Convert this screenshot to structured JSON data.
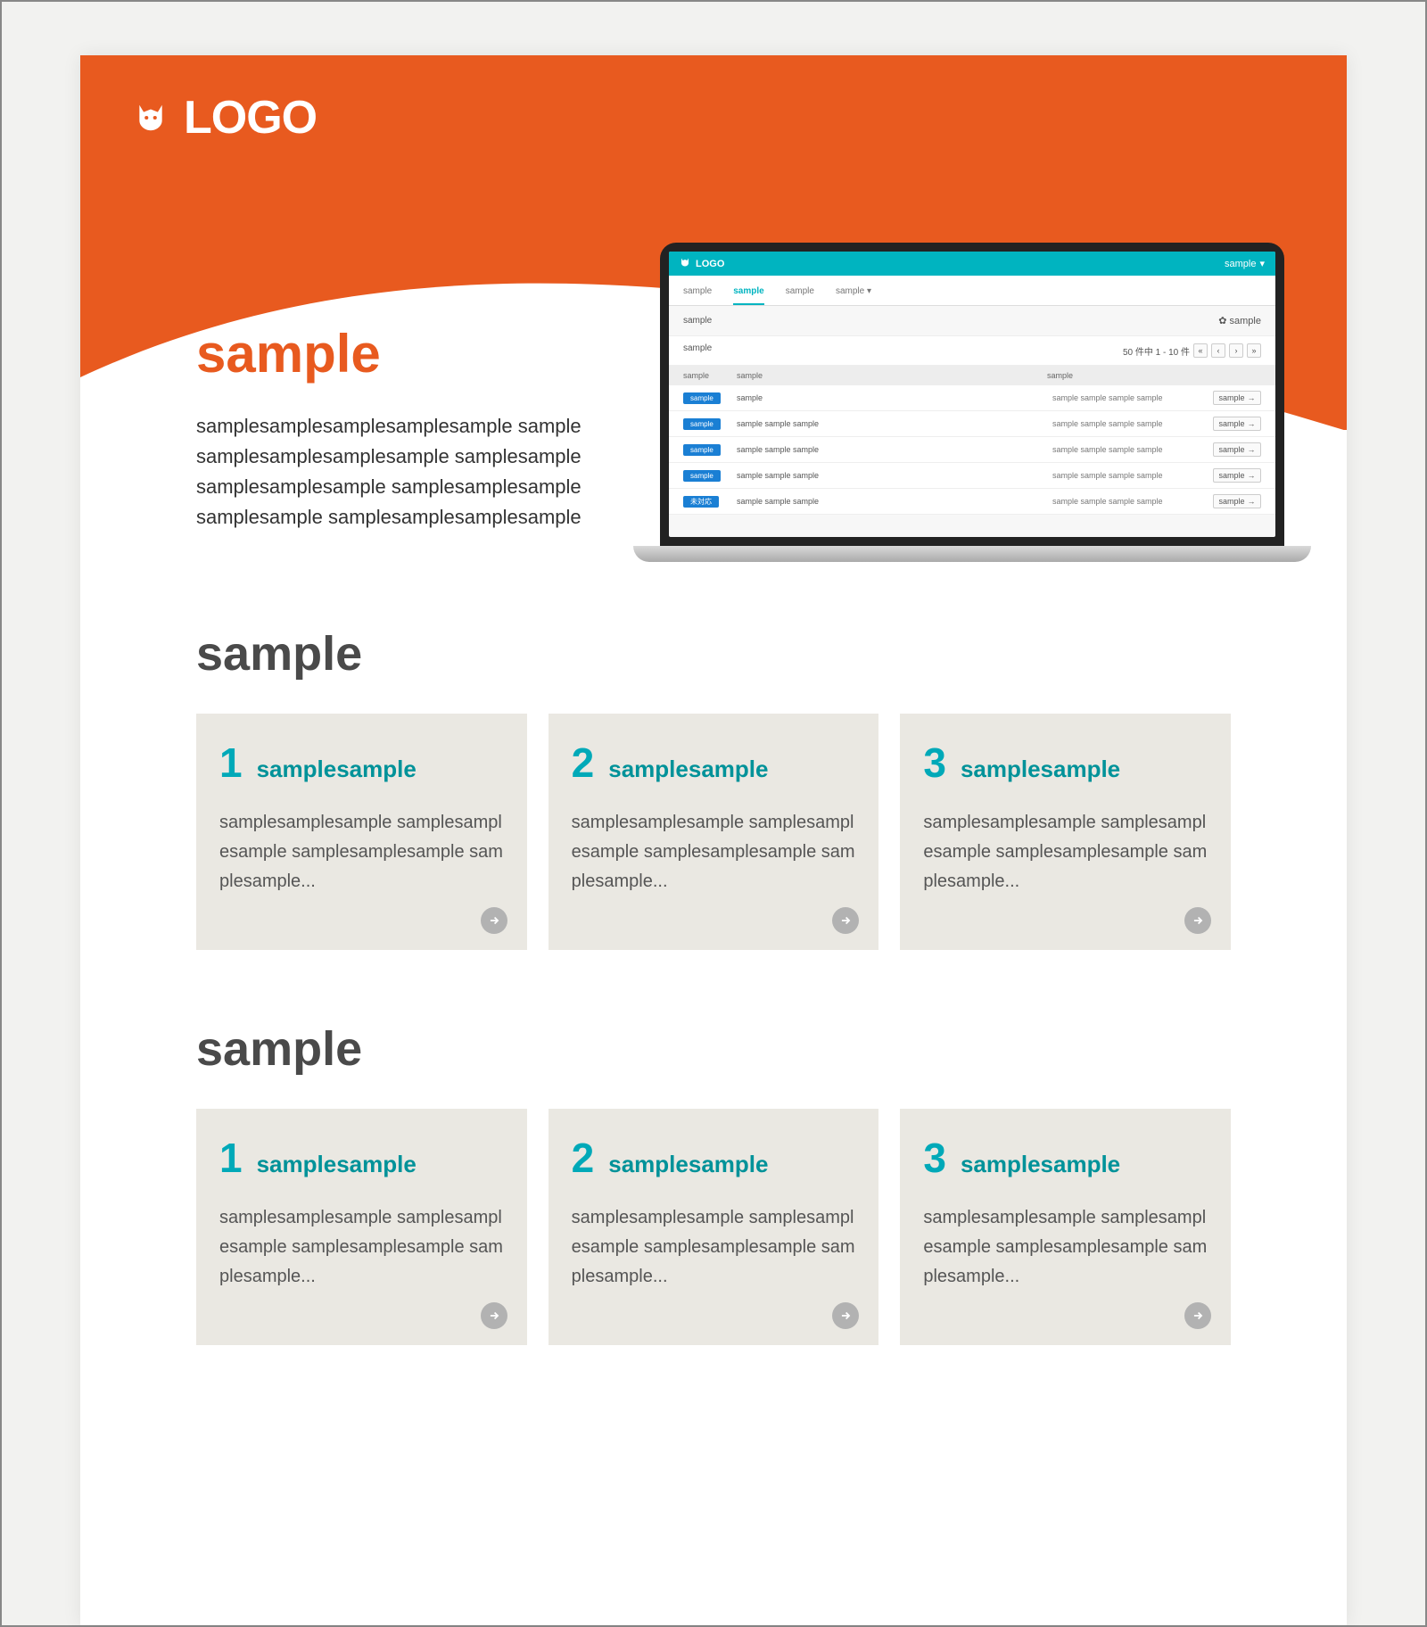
{
  "brand": {
    "logo_text": "LOGO"
  },
  "hero": {
    "title": "sample",
    "body": "samplesamplesamplesamplesample samplesamplesamplesamplesample samplesamplesamplesamplesample samplesamplesamplesamplesample samplesamplesamplesample"
  },
  "laptop": {
    "app_logo": "LOGO",
    "top_right": "sample",
    "tabs": [
      "sample",
      "sample",
      "sample",
      "sample"
    ],
    "page_title": "sample",
    "gear_label": "sample",
    "toolbar_left": "sample",
    "pager_text": "50 件中  1 - 10 件",
    "columns": {
      "c1": "sample",
      "c2": "sample",
      "c3": "sample"
    },
    "rows": [
      {
        "badge": "sample",
        "c2": "sample",
        "c3": "sample sample sample sample",
        "action": "sample"
      },
      {
        "badge": "sample",
        "c2": "sample sample sample",
        "c3": "sample sample sample sample",
        "action": "sample"
      },
      {
        "badge": "sample",
        "c2": "sample sample sample",
        "c3": "sample sample sample sample",
        "action": "sample"
      },
      {
        "badge": "sample",
        "c2": "sample sample sample",
        "c3": "sample sample sample sample",
        "action": "sample"
      },
      {
        "badge": "未対応",
        "c2": "sample sample sample",
        "c3": "sample sample sample sample",
        "action": "sample"
      }
    ]
  },
  "section1": {
    "heading": "sample",
    "cards": [
      {
        "num": "1",
        "title": "samplesample",
        "body": "samplesamplesample samplesamplesample samplesamplesample samplesample..."
      },
      {
        "num": "2",
        "title": "samplesample",
        "body": "samplesamplesample samplesamplesample samplesamplesample samplesample..."
      },
      {
        "num": "3",
        "title": "samplesample",
        "body": "samplesamplesample samplesamplesample samplesamplesample samplesample..."
      }
    ]
  },
  "section2": {
    "heading": "sample",
    "cards": [
      {
        "num": "1",
        "title": "samplesample",
        "body": "samplesamplesample samplesamplesample samplesamplesample samplesample..."
      },
      {
        "num": "2",
        "title": "samplesample",
        "body": "samplesamplesample samplesamplesample samplesamplesample samplesample..."
      },
      {
        "num": "3",
        "title": "samplesample",
        "body": "samplesamplesample samplesamplesample samplesamplesample samplesample..."
      }
    ]
  }
}
